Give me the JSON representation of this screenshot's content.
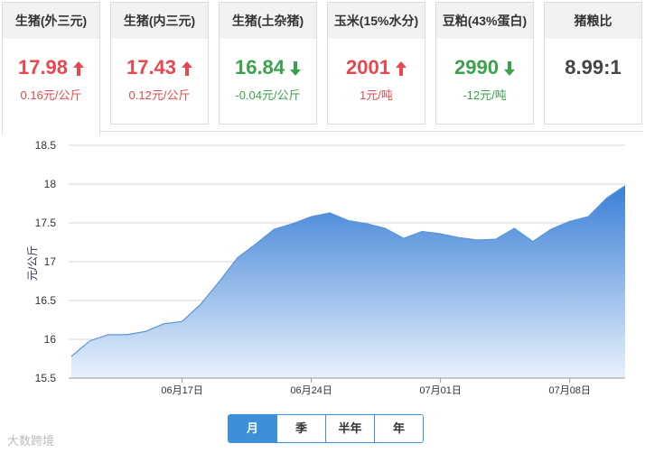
{
  "cards": [
    {
      "name": "生猪(外三元)",
      "price": "17.98",
      "change": "0.16元/公斤",
      "trend": "up",
      "active": true
    },
    {
      "name": "生猪(内三元)",
      "price": "17.43",
      "change": "0.12元/公斤",
      "trend": "up",
      "active": false
    },
    {
      "name": "生猪(土杂猪)",
      "price": "16.84",
      "change": "-0.04元/公斤",
      "trend": "down",
      "active": false
    },
    {
      "name": "玉米(15%水分)",
      "price": "2001",
      "change": "1元/吨",
      "trend": "up",
      "active": false
    },
    {
      "name": "豆粕(43%蛋白)",
      "price": "2990",
      "change": "-12元/吨",
      "trend": "down",
      "active": false
    },
    {
      "name": "猪粮比",
      "price": "8.99:1",
      "change": "",
      "trend": "none",
      "active": false
    }
  ],
  "colors": {
    "up": "#e8474f",
    "down": "#3aa24b",
    "accent": "#3d8fd8"
  },
  "periods": [
    "月",
    "季",
    "半年",
    "年"
  ],
  "selected_period": "月",
  "watermark": "大数跨境",
  "chart_data": {
    "type": "area",
    "ylabel": "元/公斤",
    "ylim": [
      15.5,
      18.5
    ],
    "yticks": [
      "18.5",
      "18",
      "17.5",
      "17",
      "16.5",
      "16",
      "15.5"
    ],
    "xtick_labels": [
      "06月17日",
      "06月24日",
      "07月01日",
      "07月08日"
    ],
    "xtick_index": [
      6,
      13,
      20,
      27
    ],
    "grid": true,
    "series": [
      {
        "values": [
          15.78,
          15.98,
          16.06,
          16.06,
          16.1,
          16.2,
          16.23,
          16.45,
          16.74,
          17.05,
          17.23,
          17.42,
          17.49,
          17.58,
          17.63,
          17.53,
          17.49,
          17.43,
          17.3,
          17.39,
          17.36,
          17.31,
          17.28,
          17.29,
          17.43,
          17.26,
          17.42,
          17.52,
          17.58,
          17.82,
          17.98
        ]
      }
    ]
  }
}
